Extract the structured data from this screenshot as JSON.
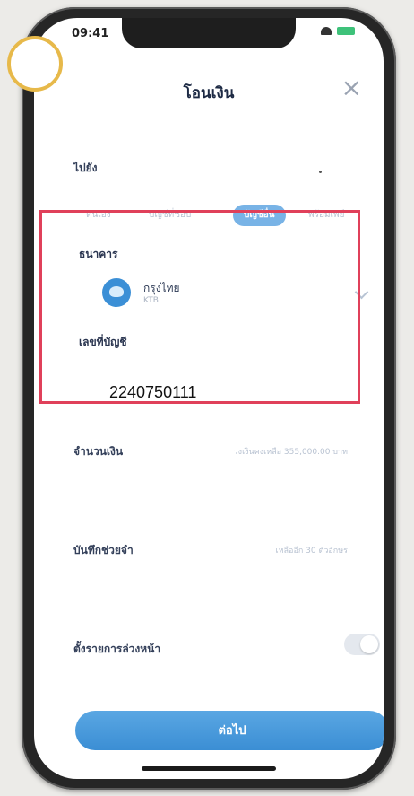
{
  "status": {
    "time": "09:41"
  },
  "header": {
    "title": "โอนเงิน",
    "close_label": "×"
  },
  "recipient_label": "ไปยัง",
  "tabs": [
    "ตนเอง",
    "บัญชีที่ชอบ",
    "บัญชีอื่น",
    "พร้อมเพย์"
  ],
  "bank": {
    "label": "ธนาคาร",
    "name": "กรุงไทย",
    "code": "KTB"
  },
  "account": {
    "label": "เลขที่บัญชี",
    "number": "2240750111"
  },
  "amount": {
    "label": "จำนวนเงิน",
    "hint": "วงเงินคงเหลือ 355,000.00 บาท"
  },
  "note": {
    "label": "บันทึกช่วยจำ",
    "hint": "เหลืออีก 30 ตัวอักษร"
  },
  "schedule": {
    "label": "ตั้งรายการล่วงหน้า",
    "enabled": false
  },
  "next_button": "ต่อไป",
  "colors": {
    "primary": "#3b8ed4",
    "highlight": "#e0405a",
    "ring": "#e7b94a"
  }
}
